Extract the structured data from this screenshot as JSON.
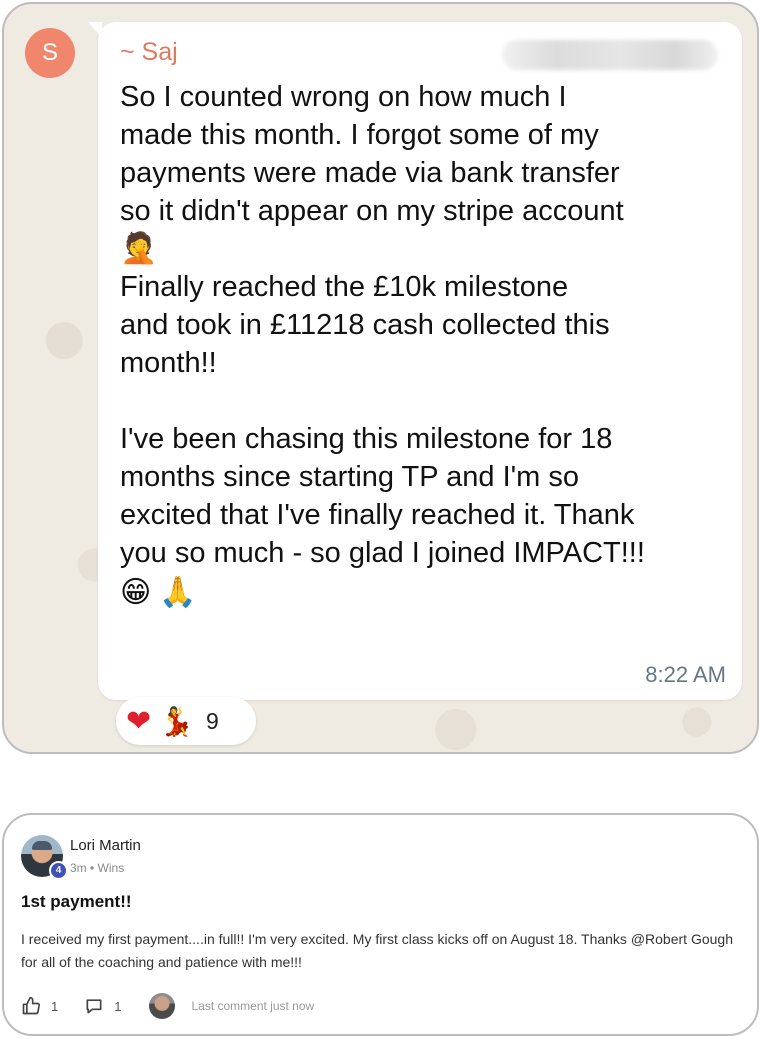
{
  "chat": {
    "avatar_letter": "S",
    "sender_name": "~ Saj",
    "paragraphs": [
      "So I counted wrong on how much I\nmade this month. I forgot some of my\npayments were made via bank transfer\nso it didn't appear on my stripe account",
      "Finally reached the £10k milestone\nand took in £11218 cash collected this\nmonth!!",
      "I've been chasing this milestone for 18\nmonths since starting TP and I'm so\nexcited that I've finally reached it. Thank\nyou so much - so glad I joined IMPACT!!!"
    ],
    "emoji_facepalm": "🤦",
    "emoji_grin": "😁",
    "emoji_pray": "🙏",
    "timestamp": "8:22 AM",
    "reactions": {
      "heart": "❤",
      "dancer": "💃",
      "count": "9"
    },
    "colors": {
      "bubble": "#ffffff",
      "background": "#efeae2",
      "sender": "#e07a5f",
      "avatar": "#f0876c"
    }
  },
  "post": {
    "author_name": "Lori Martin",
    "level": "4",
    "meta": "3m • Wins",
    "title": "1st payment!!",
    "body": "I received my first payment....in full!! I'm very excited. My first class kicks off on August 18. Thanks @Robert Gough for all of the coaching and patience with me!!!",
    "likes": "1",
    "comments": "1",
    "last_comment": "Last comment just now",
    "icons": {
      "like": "thumbs-up-icon",
      "comment": "comment-icon"
    },
    "colors": {
      "badge": "#3f51b5"
    }
  }
}
